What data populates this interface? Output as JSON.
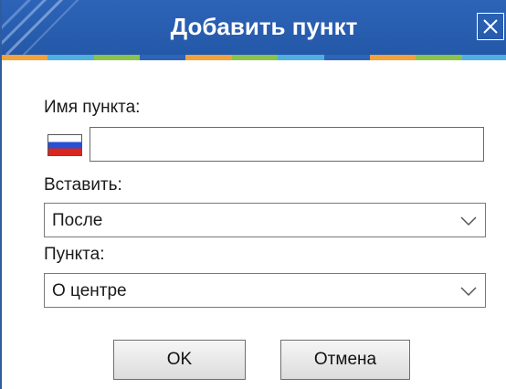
{
  "dialog": {
    "title": "Добавить пункт",
    "close_icon": "close-icon",
    "stripe_colors": [
      "#f2a23a",
      "#4fb0e0",
      "#8bc34a",
      "#2d64b8",
      "#f2a23a",
      "#8bc34a",
      "#4fb0e0",
      "#2d64b8",
      "#f2a23a",
      "#8bc34a",
      "#4fb0e0"
    ]
  },
  "form": {
    "name_label": "Имя пункта:",
    "name_value": "",
    "flag_icon": "russia-flag-icon",
    "insert_label": "Вставить:",
    "insert_value": "После",
    "item_label": "Пункта:",
    "item_value": "О центре"
  },
  "buttons": {
    "ok": "OK",
    "cancel": "Отмена"
  }
}
